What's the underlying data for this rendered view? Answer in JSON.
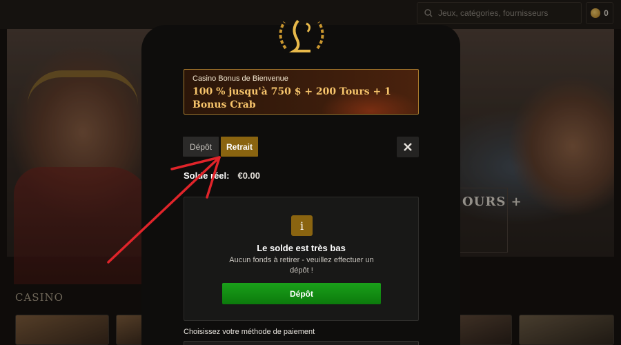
{
  "header": {
    "search_placeholder": "Jeux, catégories, fournisseurs",
    "coin_balance": "0"
  },
  "background": {
    "hero_promo_text": "OURS +",
    "section_heading": "CASINO"
  },
  "modal": {
    "banner": {
      "subtitle": "Casino Bonus de Bienvenue",
      "title": "100 % jusqu'à 750 $ + 200 Tours + 1 Bonus Crab"
    },
    "tabs": [
      {
        "label": "Dépôt",
        "active": false
      },
      {
        "label": "Retrait",
        "active": true
      }
    ],
    "balance": {
      "label": "Solde réel:",
      "value": "€0.00"
    },
    "low_balance": {
      "icon_glyph": "i",
      "title": "Le solde est très bas",
      "message": "Aucun fonds à retirer - veuillez effectuer un dépôt !",
      "cta_label": "Dépôt"
    },
    "payment_method_label": "Choisissez votre méthode de paiement"
  },
  "colors": {
    "accent_gold": "#8a6410",
    "banner_gold_text": "#f6c46b",
    "cta_green": "#129012",
    "annotation_red": "#e0242a"
  },
  "icons": [
    "search-icon",
    "coin-icon",
    "brand-logo-icon",
    "close-icon",
    "info-icon",
    "annotation-arrow-icon"
  ]
}
